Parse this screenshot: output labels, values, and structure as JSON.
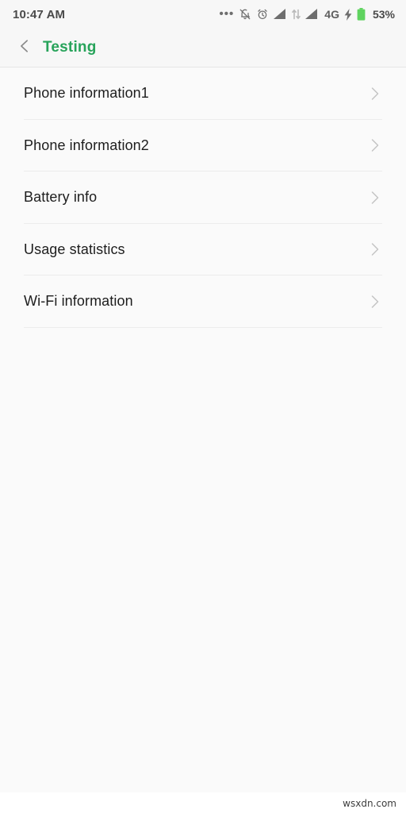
{
  "status_bar": {
    "time": "10:47 AM",
    "icons": [
      {
        "name": "more-dots-icon",
        "glyph": "•••"
      },
      {
        "name": "notifications-muted-icon",
        "glyph": "bell-slash"
      },
      {
        "name": "alarm-clock-icon",
        "glyph": "alarm"
      },
      {
        "name": "signal-bars-sim1-icon",
        "glyph": "signal"
      },
      {
        "name": "data-transfer-icon",
        "glyph": "arrows"
      },
      {
        "name": "signal-bars-sim2-icon",
        "glyph": "signal"
      }
    ],
    "network_type": "4G",
    "charging_icon": "charging-bolt-icon",
    "battery_icon": "battery-icon",
    "battery_percent": "53%",
    "battery_level": 53,
    "colors": {
      "battery_fill": "#5fd35f",
      "icon_gray": "#6e6e6e",
      "text_gray": "#4a4a4a",
      "background": "#f7f7f7"
    }
  },
  "header": {
    "back_icon": "back-chevron-icon",
    "title": "Testing",
    "title_color": "#27a35a",
    "background": "#f7f7f7"
  },
  "list": {
    "items": [
      {
        "label": "Phone information1",
        "chevron": "chevron-right-icon"
      },
      {
        "label": "Phone information2",
        "chevron": "chevron-right-icon"
      },
      {
        "label": "Battery info",
        "chevron": "chevron-right-icon"
      },
      {
        "label": "Usage statistics",
        "chevron": "chevron-right-icon"
      },
      {
        "label": "Wi-Fi information",
        "chevron": "chevron-right-icon"
      }
    ],
    "divider_color": "#ececec",
    "background": "#fafafa",
    "text_color": "#1d1d1d"
  },
  "watermark": {
    "text": "wsxdn.com"
  }
}
